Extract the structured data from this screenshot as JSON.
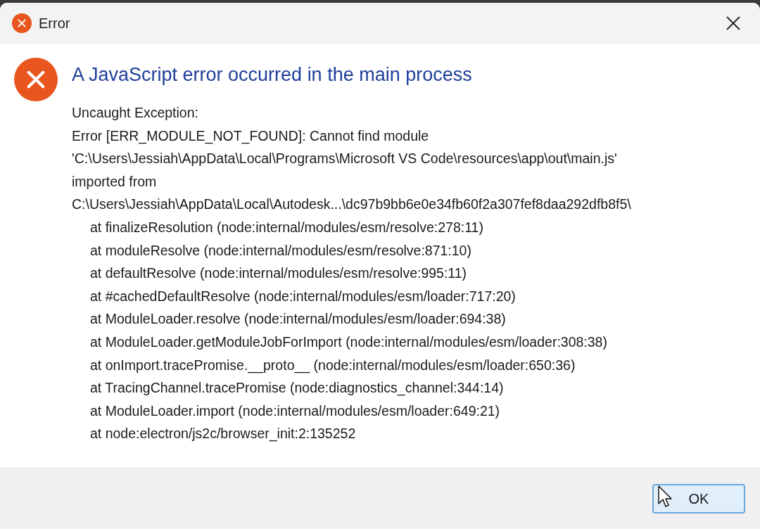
{
  "window": {
    "title": "Error"
  },
  "heading": "A JavaScript error occurred in the main process",
  "message_lines": [
    "Uncaught Exception:",
    "Error [ERR_MODULE_NOT_FOUND]: Cannot find module",
    "'C:\\Users\\Jessiah\\AppData\\Local\\Programs\\Microsoft VS Code\\resources\\app\\out\\main.js'",
    "imported from",
    "C:\\Users\\Jessiah\\AppData\\Local\\Autodesk...\\dc97b9bb6e0e34fb60f2a307fef8daa292dfb8f5\\"
  ],
  "stack_lines": [
    "at finalizeResolution (node:internal/modules/esm/resolve:278:11)",
    "at moduleResolve (node:internal/modules/esm/resolve:871:10)",
    "at defaultResolve (node:internal/modules/esm/resolve:995:11)",
    "at #cachedDefaultResolve (node:internal/modules/esm/loader:717:20)",
    "at ModuleLoader.resolve (node:internal/modules/esm/loader:694:38)",
    "at ModuleLoader.getModuleJobForImport (node:internal/modules/esm/loader:308:38)",
    "at onImport.tracePromise.__proto__ (node:internal/modules/esm/loader:650:36)",
    "at TracingChannel.tracePromise (node:diagnostics_channel:344:14)",
    "at ModuleLoader.import (node:internal/modules/esm/loader:649:21)",
    "at node:electron/js2c/browser_init:2:135252"
  ],
  "ok_button": {
    "label": "OK",
    "focused": true
  }
}
